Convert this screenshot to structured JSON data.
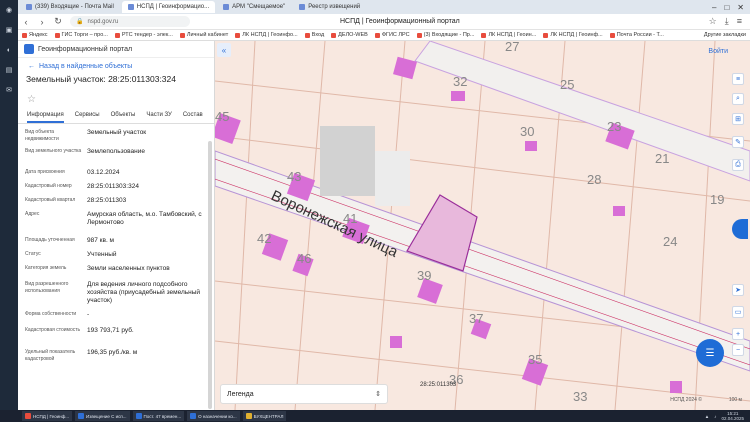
{
  "browser": {
    "tabs": [
      {
        "label": "(339) Входящие - Почта Mail",
        "active": false
      },
      {
        "label": "НСПД | Геоинформацио...",
        "active": true
      },
      {
        "label": "АРМ \"Смещаемое\"",
        "active": false
      },
      {
        "label": "Реестр извещений",
        "active": false
      }
    ],
    "url": "nspd.gov.ru",
    "doc_title": "НСПД | Геоинформационный портал",
    "bookmarks": [
      "Яндекс",
      "ГИС Торги – про...",
      "РТС тендер - элек...",
      "Личный кабинет",
      "ЛК НСПД | Геоинфо...",
      "Вход",
      "ДЕЛО-WEB",
      "ФГИС ЛРС",
      "(3) Входящие - Пр...",
      "ЛК НСПД | Геоин...",
      "ЛК НСПД | Геоинф...",
      "Почта России - Т..."
    ],
    "bookmarks_right": "Другие закладки"
  },
  "panel": {
    "header": "Геоинформационный портал",
    "back": "Назад в найденные объекты",
    "title": "Земельный участок: 28:25:011303:324",
    "tabs": [
      "Информация",
      "Сервисы",
      "Объекты",
      "Части ЗУ",
      "Состав"
    ],
    "properties": [
      {
        "key": "Вид объекта недвижимости",
        "value": "Земельный участок"
      },
      {
        "key": "Вид земельного участка",
        "value": "Землепользование"
      },
      {
        "key": "Дата присвоения",
        "value": "03.12.2024"
      },
      {
        "key": "Кадастровый номер",
        "value": "28:25:011303:324"
      },
      {
        "key": "Кадастровый квартал",
        "value": "28:25:011303"
      },
      {
        "key": "Адрес",
        "value": "Амурская область, м.о. Тамбовский, с Лермонтово"
      },
      {
        "key": "Площадь уточненная",
        "value": "987 кв. м"
      },
      {
        "key": "Статус",
        "value": "Учтенный"
      },
      {
        "key": "Категория земель",
        "value": "Земли населенных пунктов"
      },
      {
        "key": "Вид разрешенного использования",
        "value": "Для ведения личного подсобного хозяйства (приусадебный земельный участок)"
      },
      {
        "key": "Форма собственности",
        "value": "-"
      },
      {
        "key": "Кадастровая стоимость",
        "value": "193 793,71 руб."
      },
      {
        "key": "Удельный показатель кадастровой",
        "value": "196,35 руб./кв. м"
      }
    ]
  },
  "map": {
    "sign_in": "Войти",
    "street": "Воронежская улица",
    "numbers": [
      "27",
      "32",
      "25",
      "30",
      "23",
      "21",
      "28",
      "19",
      "43",
      "41",
      "42",
      "46",
      "24",
      "39",
      "37",
      "35",
      "36",
      "33",
      "45"
    ],
    "legend": "Легенда",
    "cadastral_label": "28:25:011303",
    "footer": "100 м",
    "brand": "НСПД 2024 ©"
  },
  "taskbar": {
    "items": [
      "НСПД | Геоинф...",
      "Извещение С исп...",
      "Пост. 47 времен...",
      "О назначении ко...",
      "БУХЦЕНТРАЛ"
    ],
    "time": "15:21",
    "date": "02.04.2025"
  }
}
